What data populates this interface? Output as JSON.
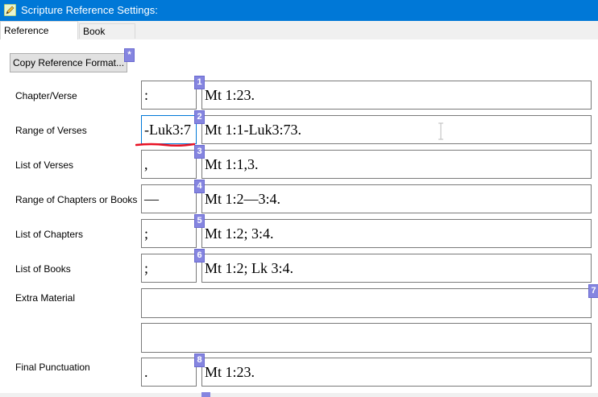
{
  "window": {
    "title": "Scripture Reference Settings:"
  },
  "tabs": [
    {
      "label": "Reference Format",
      "active": true
    },
    {
      "label": "Book Names",
      "active": false
    }
  ],
  "copy_button": {
    "label": "Copy Reference Format...",
    "badge": "*"
  },
  "rows": [
    {
      "label": "Chapter/Verse",
      "separator": ":",
      "badge": "1",
      "example": "Mt 1:23."
    },
    {
      "label": "Range of Verses",
      "separator": "-Luk3:7",
      "badge": "2",
      "example": "Mt 1:1-Luk3:73."
    },
    {
      "label": "List of Verses",
      "separator": ",",
      "badge": "3",
      "example": "Mt 1:1,3."
    },
    {
      "label": "Range of Chapters or Books",
      "separator": "—",
      "badge": "4",
      "example": "Mt 1:2—3:4."
    },
    {
      "label": "List of Chapters",
      "separator": ";",
      "badge": "5",
      "example": "Mt 1:2; 3:4."
    },
    {
      "label": "List of Books",
      "separator": ";",
      "badge": "6",
      "example": "Mt 1:2; Lk 3:4."
    }
  ],
  "extra_material": {
    "label": "Extra Material",
    "badge": "7",
    "value": "",
    "example": ""
  },
  "final_punctuation": {
    "label": "Final Punctuation",
    "separator": ".",
    "badge": "8",
    "example": "Mt 1:23."
  },
  "colors": {
    "titlebar": "#0078d7",
    "badge": "#8585e0",
    "focus": "#0078d7",
    "spellcheck": "#e81123"
  },
  "icons": {
    "app": "pencil-edit-icon",
    "cursor": "ibeam-cursor-icon"
  }
}
